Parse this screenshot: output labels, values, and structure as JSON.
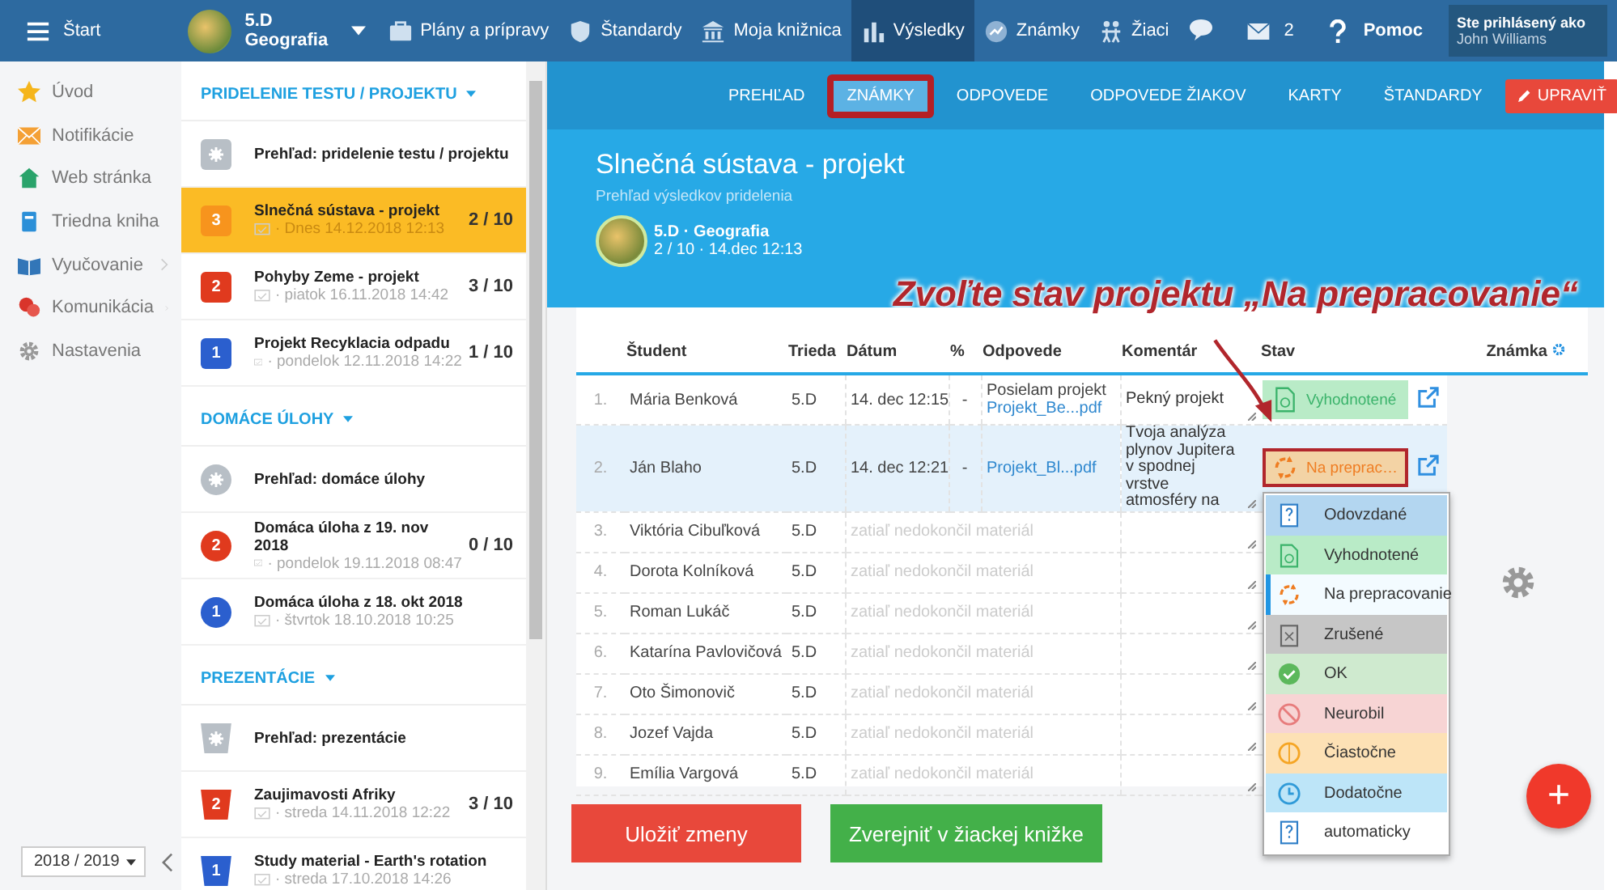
{
  "topbar": {
    "menu_label": "Štart",
    "class": {
      "name": "5.D",
      "subject": "Geografia"
    },
    "nav": [
      {
        "kind": "briefcase",
        "label": "Plány a prípravy",
        "selected": false
      },
      {
        "kind": "shield",
        "label": "Štandardy",
        "selected": false
      },
      {
        "kind": "library",
        "label": "Moja knižnica",
        "selected": false
      },
      {
        "kind": "chart",
        "label": "Výsledky",
        "selected": true
      },
      {
        "kind": "grades",
        "label": "Známky",
        "selected": false
      },
      {
        "kind": "students",
        "label": "Žiaci",
        "selected": false
      }
    ],
    "mail_count": "2",
    "help": "Pomoc",
    "user": {
      "caption": "Ste prihlásený ako",
      "name": "John Williams"
    }
  },
  "sidebar": {
    "items": [
      {
        "kind": "star",
        "label": "Úvod",
        "expandable": false
      },
      {
        "kind": "mail",
        "label": "Notifikácie",
        "expandable": false
      },
      {
        "kind": "home",
        "label": "Web stránka",
        "expandable": false
      },
      {
        "kind": "book",
        "label": "Triedna kniha",
        "expandable": false
      },
      {
        "kind": "open-book",
        "label": "Vyučovanie",
        "expandable": true
      },
      {
        "kind": "chat",
        "label": "Komunikácia",
        "expandable": true
      },
      {
        "kind": "gear",
        "label": "Nastavenia",
        "expandable": false
      }
    ],
    "year": "2018 / 2019"
  },
  "assignments": {
    "sections": [
      {
        "title": "PRIDELENIE TESTU / PROJEKTU",
        "kind": "square",
        "items": [
          {
            "kind": "overview",
            "title": "Prehľad: pridelenie testu / projektu",
            "selected": false
          },
          {
            "kind": "item",
            "badge": "3",
            "color": "#f7941d",
            "title": "Slnečná sústava - projekt",
            "date": "· Dnes 14.12.2018 12:13",
            "score": "2 / 10",
            "selected": true
          },
          {
            "kind": "item",
            "badge": "2",
            "color": "#e03a1e",
            "title": "Pohyby Zeme - projekt",
            "date": "· piatok 16.11.2018 14:42",
            "score": "3 / 10",
            "selected": false
          },
          {
            "kind": "item",
            "badge": "1",
            "color": "#2b5fce",
            "title": "Projekt Recyklacia odpadu",
            "date": "· pondelok 12.11.2018 14:22",
            "score": "1 / 10",
            "selected": false
          }
        ]
      },
      {
        "title": "DOMÁCE ÚLOHY",
        "kind": "circle",
        "items": [
          {
            "kind": "overview",
            "title": "Prehľad: domáce úlohy",
            "selected": false
          },
          {
            "kind": "item",
            "badge": "2",
            "color": "#e03a1e",
            "title": "Domáca úloha z 19. nov 2018",
            "date": "· pondelok 19.11.2018 08:47",
            "score": "0 / 10",
            "selected": false
          },
          {
            "kind": "item",
            "badge": "1",
            "color": "#2b5fce",
            "title": "Domáca úloha z 18. okt 2018",
            "date": "· štvrtok 18.10.2018 10:25",
            "selected": false
          }
        ]
      },
      {
        "title": "PREZENTÁCIE",
        "kind": "cup",
        "items": [
          {
            "kind": "overview",
            "title": "Prehľad: prezentácie",
            "selected": false
          },
          {
            "kind": "item",
            "badge": "2",
            "color": "#e03a1e",
            "title": "Zaujimavosti Afriky",
            "date": "· streda 14.11.2018 12:22",
            "score": "3 / 10",
            "selected": false
          },
          {
            "kind": "item",
            "badge": "1",
            "color": "#2b5fce",
            "title": "Study material - Earth's rotation",
            "date": "· streda 17.10.2018 14:26",
            "selected": false
          }
        ]
      }
    ]
  },
  "content": {
    "tabs": [
      {
        "label": "PREHĽAD",
        "selected": false
      },
      {
        "label": "ZNÁMKY",
        "selected": true
      },
      {
        "label": "ODPOVEDE",
        "selected": false
      },
      {
        "label": "ODPOVEDE ŽIAKOV",
        "selected": false
      },
      {
        "label": "KARTY",
        "selected": false
      },
      {
        "label": "ŠTANDARDY",
        "selected": false
      }
    ],
    "edit_button": "UPRAVIŤ",
    "title": "Slnečná sústava - projekt",
    "subtitle": "Prehľad výsledkov pridelenia",
    "class_info": {
      "name": "5.D · Geografia",
      "meta": "2 / 10 · 14.dec 12:13"
    },
    "annotation": "Zvoľte stav projektu „Na prepracovanie“",
    "table": {
      "columns": [
        "Študent",
        "Trieda",
        "Dátum",
        "%",
        "Odpovede",
        "Komentár",
        "Stav",
        "Známka"
      ],
      "rows": [
        {
          "index": "1.",
          "student": "Mária Benková",
          "class": "5.D",
          "date": "14. dec 12:15",
          "percent": "-",
          "answer_text": "Posielam projekt",
          "answer_link": "Projekt_Be...pdf",
          "comment": "Pekný projekt",
          "status": {
            "label": "Vyhodnotené",
            "kind": "evaluated",
            "open": false
          },
          "selected": false
        },
        {
          "index": "2.",
          "student": "Ján Blaho",
          "class": "5.D",
          "date": "14. dec 12:21",
          "percent": "-",
          "answer_link": "Projekt_Bl...pdf",
          "comment": "Tvoja analýza plynov Jupitera v spodnej vrstve atmosféry na",
          "status": {
            "label": "Na preprac…",
            "kind": "rework",
            "open": true
          },
          "selected": true
        },
        {
          "index": "3.",
          "student": "Viktória Cibuľková",
          "class": "5.D",
          "note": "zatiaľ nedokončil materiál",
          "selected": false
        },
        {
          "index": "4.",
          "student": "Dorota Kolníková",
          "class": "5.D",
          "note": "zatiaľ nedokončil materiál",
          "selected": false
        },
        {
          "index": "5.",
          "student": "Roman Lukáč",
          "class": "5.D",
          "note": "zatiaľ nedokončil materiál",
          "selected": false
        },
        {
          "index": "6.",
          "student": "Katarína Pavlovičová",
          "class": "5.D",
          "note": "zatiaľ nedokončil materiál",
          "selected": false
        },
        {
          "index": "7.",
          "student": "Oto Šimonovič",
          "class": "5.D",
          "note": "zatiaľ nedokončil materiál",
          "selected": false
        },
        {
          "index": "8.",
          "student": "Jozef Vajda",
          "class": "5.D",
          "note": "zatiaľ nedokončil materiál",
          "selected": false
        },
        {
          "index": "9.",
          "student": "Emília Vargová",
          "class": "5.D",
          "note": "zatiaľ nedokončil materiál",
          "selected": false
        }
      ]
    },
    "status_options": [
      {
        "label": "Odovzdané",
        "kind": "submitted",
        "selected": false
      },
      {
        "label": "Vyhodnotené",
        "kind": "evaluated",
        "selected": false
      },
      {
        "label": "Na prepracovanie",
        "kind": "rework",
        "selected": true
      },
      {
        "label": "Zrušené",
        "kind": "cancelled",
        "selected": false
      },
      {
        "label": "OK",
        "kind": "ok",
        "selected": false
      },
      {
        "label": "Neurobil",
        "kind": "failed",
        "selected": false
      },
      {
        "label": "Čiastočne",
        "kind": "partial",
        "selected": false
      },
      {
        "label": "Dodatočne",
        "kind": "late",
        "selected": false
      },
      {
        "label": "automaticky",
        "kind": "auto",
        "selected": false
      }
    ],
    "buttons": [
      {
        "label": "Uložiť zmeny",
        "kind": "danger"
      },
      {
        "label": "Zverejniť v žiackej knižke",
        "kind": "success"
      }
    ],
    "fab": "+"
  }
}
